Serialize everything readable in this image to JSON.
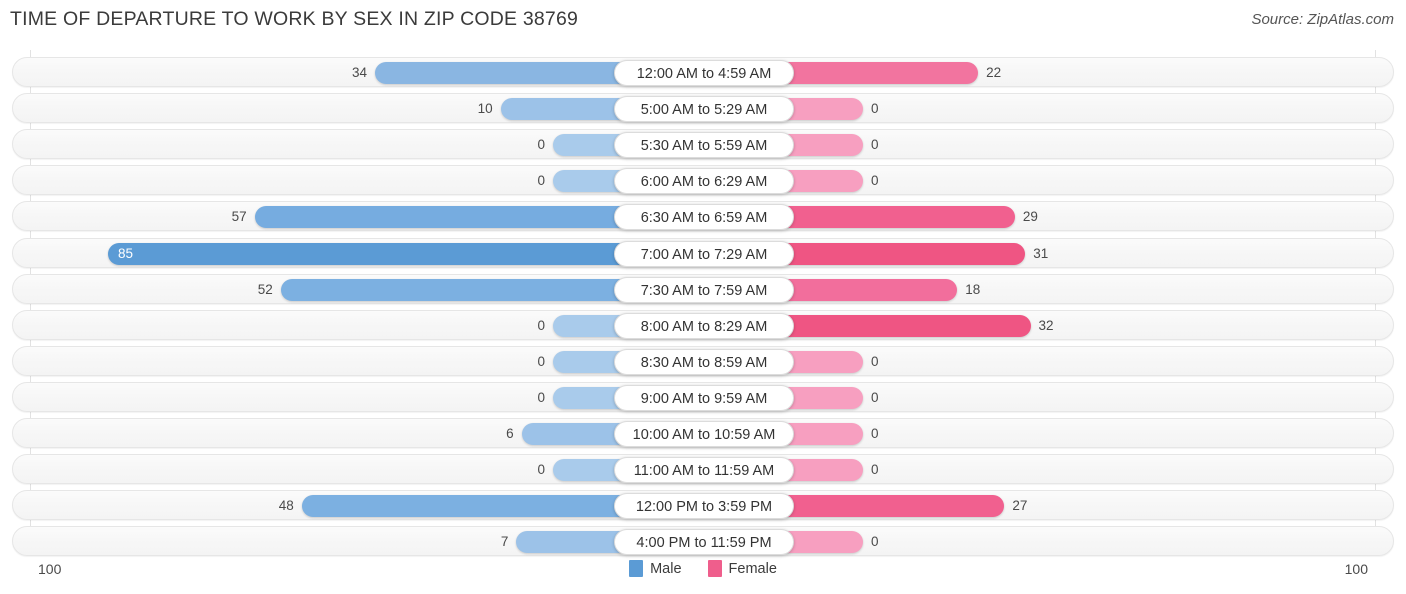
{
  "header": {
    "title": "TIME OF DEPARTURE TO WORK BY SEX IN ZIP CODE 38769",
    "source": "Source: ZipAtlas.com"
  },
  "axis": {
    "left_tick": "100",
    "right_tick": "100"
  },
  "legend": {
    "items": [
      {
        "label": "Male",
        "color": "#5b9bd5"
      },
      {
        "label": "Female",
        "color": "#ef5e8c"
      }
    ]
  },
  "chart_data": {
    "type": "bar",
    "orientation": "horizontal-diverging",
    "title": "TIME OF DEPARTURE TO WORK BY SEX IN ZIP CODE 38769",
    "xlabel": "",
    "ylabel": "",
    "xlim": [
      100,
      100
    ],
    "grid": false,
    "legend_position": "bottom-center",
    "categories": [
      "12:00 AM to 4:59 AM",
      "5:00 AM to 5:29 AM",
      "5:30 AM to 5:59 AM",
      "6:00 AM to 6:29 AM",
      "6:30 AM to 6:59 AM",
      "7:00 AM to 7:29 AM",
      "7:30 AM to 7:59 AM",
      "8:00 AM to 8:29 AM",
      "8:30 AM to 8:59 AM",
      "9:00 AM to 9:59 AM",
      "10:00 AM to 10:59 AM",
      "11:00 AM to 11:59 AM",
      "12:00 PM to 3:59 PM",
      "4:00 PM to 11:59 PM"
    ],
    "series": [
      {
        "name": "Male",
        "color": "#5b9bd5",
        "values": [
          34,
          10,
          0,
          0,
          57,
          85,
          52,
          0,
          0,
          0,
          6,
          0,
          48,
          7
        ]
      },
      {
        "name": "Female",
        "color": "#ef5e8c",
        "values": [
          22,
          0,
          0,
          0,
          29,
          31,
          18,
          32,
          0,
          0,
          0,
          0,
          27,
          0
        ]
      }
    ]
  },
  "rows": [
    {
      "label": "12:00 AM to 4:59 AM",
      "male": "34",
      "female": "22",
      "male_color": "#8ab6e2",
      "female_color": "#f2749f"
    },
    {
      "label": "5:00 AM to 5:29 AM",
      "male": "10",
      "female": "0",
      "male_color": "#9cc2e8",
      "female_color": "#f79fc0"
    },
    {
      "label": "5:30 AM to 5:59 AM",
      "male": "0",
      "female": "0",
      "male_color": "#a9cbeb",
      "female_color": "#f79fc0"
    },
    {
      "label": "6:00 AM to 6:29 AM",
      "male": "0",
      "female": "0",
      "male_color": "#a9cbeb",
      "female_color": "#f79fc0"
    },
    {
      "label": "6:30 AM to 6:59 AM",
      "male": "57",
      "female": "29",
      "male_color": "#76ace0",
      "female_color": "#f1608f"
    },
    {
      "label": "7:00 AM to 7:29 AM",
      "male": "85",
      "female": "31",
      "male_color": "#5b9bd5",
      "female_color": "#ef5583"
    },
    {
      "label": "7:30 AM to 7:59 AM",
      "male": "52",
      "female": "18",
      "male_color": "#7cb0e1",
      "female_color": "#f26e9c"
    },
    {
      "label": "8:00 AM to 8:29 AM",
      "male": "0",
      "female": "32",
      "male_color": "#a9cbeb",
      "female_color": "#ef5583"
    },
    {
      "label": "8:30 AM to 8:59 AM",
      "male": "0",
      "female": "0",
      "male_color": "#a9cbeb",
      "female_color": "#f79fc0"
    },
    {
      "label": "9:00 AM to 9:59 AM",
      "male": "0",
      "female": "0",
      "male_color": "#a9cbeb",
      "female_color": "#f79fc0"
    },
    {
      "label": "10:00 AM to 10:59 AM",
      "male": "6",
      "female": "0",
      "male_color": "#9cc2e8",
      "female_color": "#f79fc0"
    },
    {
      "label": "11:00 AM to 11:59 AM",
      "male": "0",
      "female": "0",
      "male_color": "#a9cbeb",
      "female_color": "#f79fc0"
    },
    {
      "label": "12:00 PM to 3:59 PM",
      "male": "48",
      "female": "27",
      "male_color": "#7cb0e1",
      "female_color": "#f1608f"
    },
    {
      "label": "4:00 PM to 11:59 PM",
      "male": "7",
      "female": "0",
      "male_color": "#9cc2e8",
      "female_color": "#f79fc0"
    }
  ]
}
